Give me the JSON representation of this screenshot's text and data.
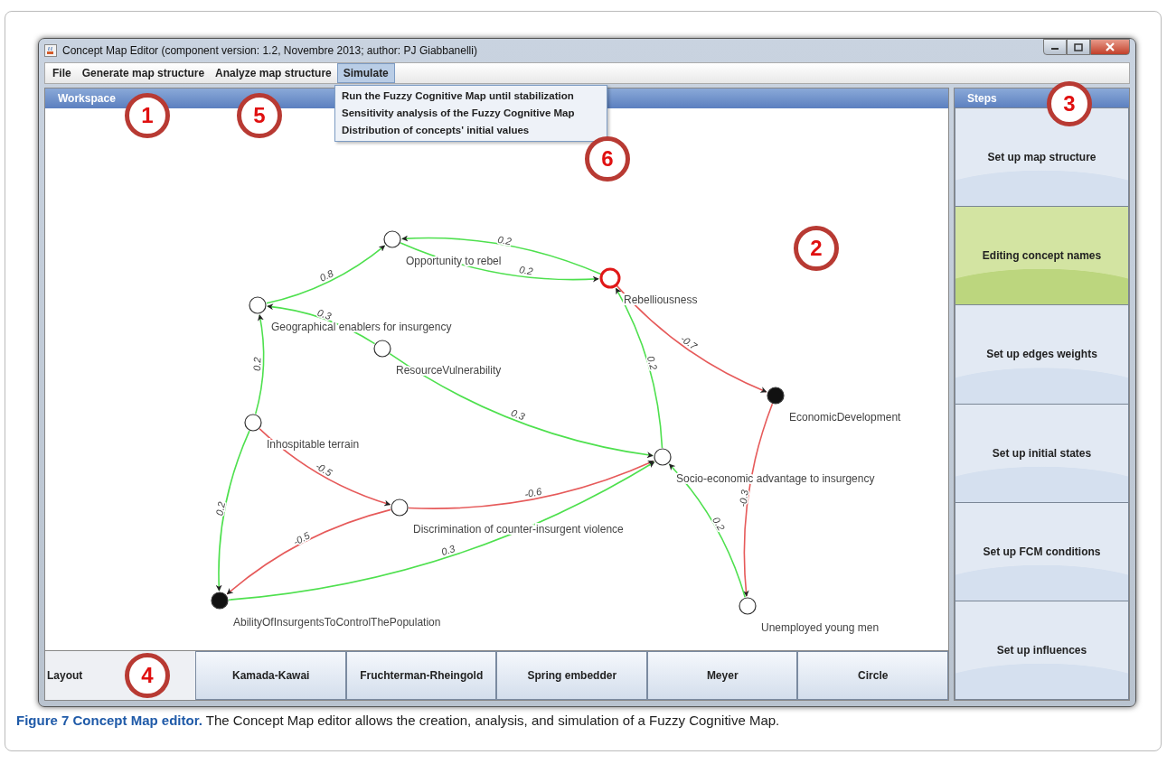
{
  "window": {
    "title": "Concept Map Editor (component version: 1.2, Novembre 2013; author: PJ Giabbanelli)"
  },
  "menu": [
    {
      "label": "File",
      "selected": false
    },
    {
      "label": "Generate map structure",
      "selected": false
    },
    {
      "label": "Analyze map structure",
      "selected": false
    },
    {
      "label": "Simulate",
      "selected": true
    }
  ],
  "dropdown": [
    "Run the Fuzzy Cognitive Map until stabilization",
    "Sensitivity analysis of the Fuzzy Cognitive Map",
    "Distribution of concepts' initial values"
  ],
  "workspace": {
    "title": "Workspace",
    "nodes": [
      {
        "label": "Opportunity to rebel",
        "filled": false,
        "selected": false
      },
      {
        "label": "Rebelliousness",
        "filled": false,
        "selected": true
      },
      {
        "label": "Geographical enablers for insurgency",
        "filled": false,
        "selected": false
      },
      {
        "label": "ResourceVulnerability",
        "filled": false,
        "selected": false
      },
      {
        "label": "EconomicDevelopment",
        "filled": true,
        "selected": false
      },
      {
        "label": "Inhospitable terrain",
        "filled": false,
        "selected": false
      },
      {
        "label": "Socio-economic advantage to insurgency",
        "filled": false,
        "selected": false
      },
      {
        "label": "Discrimination of counter-insurgent violence",
        "filled": false,
        "selected": false
      },
      {
        "label": "AbilityOfInsurgentsToControlThePopulation",
        "filled": true,
        "selected": false
      },
      {
        "label": "Unemployed young men",
        "filled": false,
        "selected": false
      }
    ],
    "edges": [
      {
        "weight": "0.2",
        "color": "#4ee04e"
      },
      {
        "weight": "0.2",
        "color": "#4ee04e"
      },
      {
        "weight": "0.8",
        "color": "#4ee04e"
      },
      {
        "weight": "0.3",
        "color": "#4ee04e"
      },
      {
        "weight": "0.2",
        "color": "#4ee04e"
      },
      {
        "weight": "0.3",
        "color": "#4ee04e"
      },
      {
        "weight": "0.2",
        "color": "#4ee04e"
      },
      {
        "weight": "-0.7",
        "color": "#e65a5a"
      },
      {
        "weight": "-0.3",
        "color": "#e65a5a"
      },
      {
        "weight": "-0.5",
        "color": "#e65a5a"
      },
      {
        "weight": "-0.6",
        "color": "#e65a5a"
      },
      {
        "weight": "0.3",
        "color": "#4ee04e"
      },
      {
        "weight": "-0.5",
        "color": "#e65a5a"
      },
      {
        "weight": "0.2",
        "color": "#4ee04e"
      },
      {
        "weight": "0.2",
        "color": "#4ee04e"
      }
    ]
  },
  "steps": {
    "title": "Steps",
    "items": [
      {
        "label": "Set up map structure",
        "selected": false
      },
      {
        "label": "Editing concept names",
        "selected": true
      },
      {
        "label": "Set up edges weights",
        "selected": false
      },
      {
        "label": "Set up initial states",
        "selected": false
      },
      {
        "label": "Set up FCM conditions",
        "selected": false
      },
      {
        "label": "Set up influences",
        "selected": false
      }
    ]
  },
  "layout": {
    "label": "Layout",
    "buttons": [
      "Kamada-Kawai",
      "Fruchterman-Rheingold",
      "Spring embedder",
      "Meyer",
      "Circle"
    ]
  },
  "annotations": [
    "1",
    "5",
    "6",
    "3",
    "2",
    "4"
  ],
  "caption": "**Figure 7 Concept Map editor.** The Concept Map editor allows the creation, analysis, and simulation of a Fuzzy Cognitive Map."
}
